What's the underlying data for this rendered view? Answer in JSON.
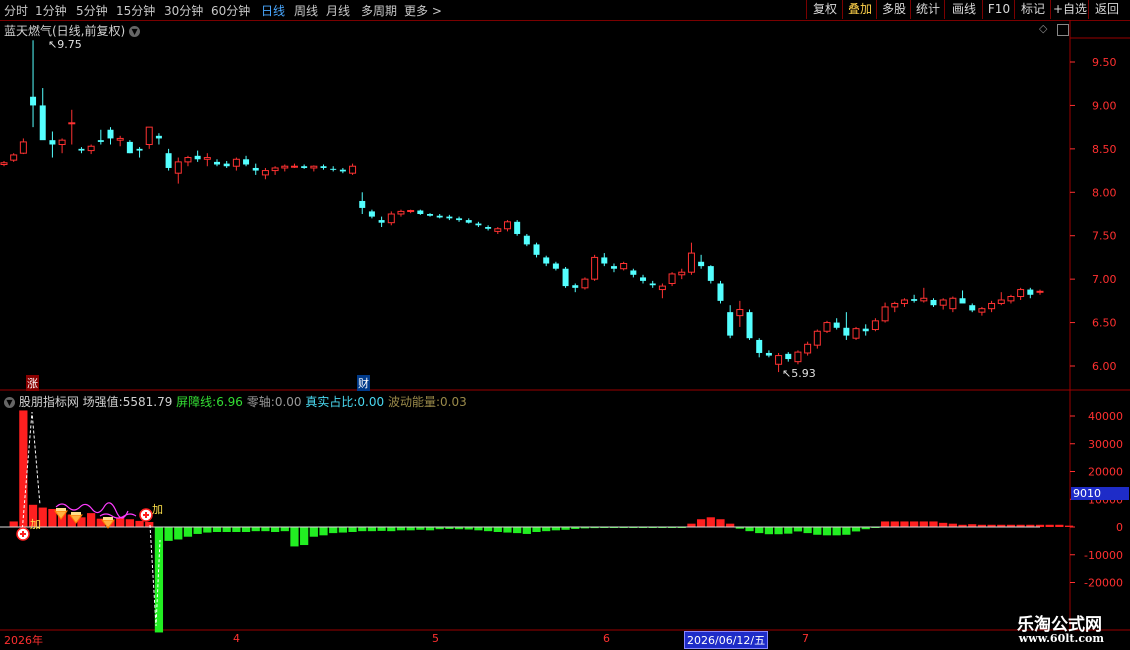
{
  "toolbar": {
    "periods": [
      "分时",
      "1分钟",
      "5分钟",
      "15分钟",
      "30分钟",
      "60分钟",
      "日线",
      "周线",
      "月线",
      "多周期",
      "更多"
    ],
    "active_period": "日线",
    "more_arrow": ">",
    "right_buttons": [
      "复权",
      "叠加",
      "多股",
      "统计",
      "画线",
      "F10",
      "标记",
      "+自选",
      "返回"
    ],
    "active_right": "叠加"
  },
  "main_chart": {
    "title": "蓝天燃气(日线,前复权)",
    "max_label": "9.75",
    "min_label": "5.93",
    "marker_zhang": "涨",
    "marker_cai": "财",
    "y_ticks": [
      "9.50",
      "9.00",
      "8.50",
      "8.00",
      "7.50",
      "7.00",
      "6.50",
      "6.00"
    ]
  },
  "indicator": {
    "name": "股朋指标网",
    "field1_label": "场强值:",
    "field1_value": "5581.79",
    "field2_label": "屏障线:",
    "field2_value": "6.96",
    "field3_label": "零轴:",
    "field3_value": "0.00",
    "field4_label": "真实占比:",
    "field4_value": "0.00",
    "field5_label": "波动能量:",
    "field5_value": "0.03",
    "y_ticks": [
      "40000",
      "30000",
      "20000",
      "10000",
      "0",
      "-10000",
      "-20000"
    ],
    "current_value": "9010",
    "add_label": "加",
    "colors": {
      "positive": "#ff2020",
      "negative": "#22ee22",
      "field2": "#33dd33",
      "field3": "#999999",
      "field4": "#4ad8f0",
      "field5": "#9a8a4a"
    }
  },
  "date_axis": {
    "labels": [
      "2026年",
      "4",
      "5",
      "6",
      "7"
    ],
    "cursor_date": "2026/06/12/五"
  },
  "watermark": {
    "line1": "乐淘公式网",
    "line2": "www.60lt.com"
  },
  "chart_data": {
    "type": "candlestick",
    "ylim": [
      5.75,
      9.9
    ],
    "candles": [
      [
        8.32,
        8.36,
        8.3,
        8.34
      ],
      [
        8.37,
        8.45,
        8.35,
        8.43
      ],
      [
        8.45,
        8.62,
        8.44,
        8.58
      ],
      [
        9.1,
        9.75,
        8.75,
        9.0
      ],
      [
        9.0,
        9.2,
        8.9,
        8.6
      ],
      [
        8.6,
        8.7,
        8.4,
        8.55
      ],
      [
        8.55,
        8.62,
        8.45,
        8.6
      ],
      [
        8.8,
        8.95,
        8.55,
        8.8
      ],
      [
        8.5,
        8.52,
        8.45,
        8.48
      ],
      [
        8.48,
        8.55,
        8.44,
        8.53
      ],
      [
        8.6,
        8.72,
        8.55,
        8.58
      ],
      [
        8.72,
        8.75,
        8.55,
        8.62
      ],
      [
        8.6,
        8.65,
        8.53,
        8.62
      ],
      [
        8.58,
        8.6,
        8.45,
        8.45
      ],
      [
        8.5,
        8.52,
        8.4,
        8.48
      ],
      [
        8.55,
        8.72,
        8.5,
        8.75
      ],
      [
        8.65,
        8.68,
        8.55,
        8.62
      ],
      [
        8.45,
        8.5,
        8.25,
        8.28
      ],
      [
        8.22,
        8.4,
        8.1,
        8.35
      ],
      [
        8.35,
        8.42,
        8.3,
        8.4
      ],
      [
        8.42,
        8.48,
        8.35,
        8.38
      ],
      [
        8.38,
        8.45,
        8.3,
        8.4
      ],
      [
        8.35,
        8.38,
        8.3,
        8.32
      ],
      [
        8.33,
        8.36,
        8.28,
        8.3
      ],
      [
        8.3,
        8.4,
        8.25,
        8.38
      ],
      [
        8.38,
        8.42,
        8.3,
        8.32
      ],
      [
        8.28,
        8.33,
        8.2,
        8.25
      ],
      [
        8.2,
        8.28,
        8.15,
        8.25
      ],
      [
        8.25,
        8.3,
        8.2,
        8.28
      ],
      [
        8.28,
        8.32,
        8.24,
        8.3
      ],
      [
        8.3,
        8.33,
        8.28,
        8.3
      ],
      [
        8.3,
        8.32,
        8.27,
        8.28
      ],
      [
        8.28,
        8.31,
        8.24,
        8.3
      ],
      [
        8.3,
        8.32,
        8.26,
        8.28
      ],
      [
        8.27,
        8.3,
        8.24,
        8.26
      ],
      [
        8.26,
        8.28,
        8.22,
        8.24
      ],
      [
        8.22,
        8.33,
        8.2,
        8.3
      ],
      [
        7.9,
        8.0,
        7.75,
        7.82
      ],
      [
        7.78,
        7.8,
        7.7,
        7.72
      ],
      [
        7.68,
        7.72,
        7.6,
        7.65
      ],
      [
        7.65,
        7.78,
        7.62,
        7.75
      ],
      [
        7.75,
        7.8,
        7.72,
        7.78
      ],
      [
        7.78,
        7.8,
        7.76,
        7.79
      ],
      [
        7.79,
        7.8,
        7.74,
        7.75
      ],
      [
        7.75,
        7.76,
        7.72,
        7.73
      ],
      [
        7.73,
        7.75,
        7.7,
        7.71
      ],
      [
        7.72,
        7.74,
        7.68,
        7.7
      ],
      [
        7.7,
        7.72,
        7.66,
        7.68
      ],
      [
        7.68,
        7.7,
        7.64,
        7.65
      ],
      [
        7.64,
        7.66,
        7.6,
        7.62
      ],
      [
        7.6,
        7.62,
        7.56,
        7.58
      ],
      [
        7.55,
        7.6,
        7.52,
        7.58
      ],
      [
        7.58,
        7.68,
        7.55,
        7.66
      ],
      [
        7.66,
        7.68,
        7.5,
        7.52
      ],
      [
        7.5,
        7.52,
        7.38,
        7.4
      ],
      [
        7.4,
        7.42,
        7.25,
        7.28
      ],
      [
        7.25,
        7.27,
        7.15,
        7.18
      ],
      [
        7.18,
        7.2,
        7.1,
        7.12
      ],
      [
        7.12,
        7.14,
        6.9,
        6.92
      ],
      [
        6.93,
        6.95,
        6.85,
        6.9
      ],
      [
        6.9,
        7.02,
        6.88,
        7.0
      ],
      [
        7.0,
        7.28,
        6.98,
        7.25
      ],
      [
        7.25,
        7.3,
        7.15,
        7.18
      ],
      [
        7.15,
        7.18,
        7.08,
        7.12
      ],
      [
        7.12,
        7.2,
        7.1,
        7.18
      ],
      [
        7.1,
        7.12,
        7.02,
        7.05
      ],
      [
        7.02,
        7.05,
        6.95,
        6.98
      ],
      [
        6.95,
        6.98,
        6.9,
        6.93
      ],
      [
        6.88,
        6.95,
        6.78,
        6.92
      ],
      [
        6.95,
        7.08,
        6.92,
        7.06
      ],
      [
        7.05,
        7.12,
        7.0,
        7.08
      ],
      [
        7.08,
        7.42,
        7.05,
        7.3
      ],
      [
        7.2,
        7.28,
        7.12,
        7.15
      ],
      [
        7.15,
        7.16,
        6.95,
        6.98
      ],
      [
        6.95,
        6.98,
        6.72,
        6.75
      ],
      [
        6.62,
        6.7,
        6.32,
        6.35
      ],
      [
        6.58,
        6.75,
        6.45,
        6.65
      ],
      [
        6.62,
        6.65,
        6.3,
        6.32
      ],
      [
        6.3,
        6.32,
        6.1,
        6.15
      ],
      [
        6.15,
        6.18,
        6.1,
        6.12
      ],
      [
        6.02,
        6.15,
        5.93,
        6.12
      ],
      [
        6.14,
        6.16,
        6.05,
        6.08
      ],
      [
        6.05,
        6.18,
        6.02,
        6.16
      ],
      [
        6.15,
        6.28,
        6.12,
        6.25
      ],
      [
        6.24,
        6.42,
        6.2,
        6.4
      ],
      [
        6.4,
        6.52,
        6.38,
        6.5
      ],
      [
        6.5,
        6.55,
        6.42,
        6.44
      ],
      [
        6.44,
        6.62,
        6.3,
        6.35
      ],
      [
        6.32,
        6.45,
        6.3,
        6.43
      ],
      [
        6.43,
        6.48,
        6.35,
        6.4
      ],
      [
        6.42,
        6.55,
        6.4,
        6.52
      ],
      [
        6.52,
        6.73,
        6.5,
        6.68
      ],
      [
        6.68,
        6.74,
        6.62,
        6.72
      ],
      [
        6.72,
        6.78,
        6.68,
        6.76
      ],
      [
        6.77,
        6.82,
        6.73,
        6.75
      ],
      [
        6.75,
        6.9,
        6.73,
        6.78
      ],
      [
        6.76,
        6.78,
        6.68,
        6.7
      ],
      [
        6.7,
        6.78,
        6.65,
        6.76
      ],
      [
        6.66,
        6.8,
        6.62,
        6.78
      ],
      [
        6.78,
        6.87,
        6.75,
        6.72
      ],
      [
        6.7,
        6.72,
        6.62,
        6.64
      ],
      [
        6.62,
        6.68,
        6.58,
        6.66
      ],
      [
        6.66,
        6.75,
        6.62,
        6.72
      ],
      [
        6.72,
        6.85,
        6.7,
        6.76
      ],
      [
        6.75,
        6.82,
        6.72,
        6.8
      ],
      [
        6.8,
        6.9,
        6.76,
        6.88
      ],
      [
        6.88,
        6.9,
        6.78,
        6.82
      ],
      [
        6.85,
        6.88,
        6.82,
        6.86
      ]
    ],
    "indicator_values": [
      0,
      2000,
      42000,
      8000,
      7000,
      6500,
      5500,
      4500,
      3500,
      5000,
      3000,
      2500,
      3200,
      2800,
      2200,
      1800,
      -38000,
      -5000,
      -4500,
      -3500,
      -2500,
      -2000,
      -1800,
      -1800,
      -1800,
      -1800,
      -1500,
      -1500,
      -1800,
      -1500,
      -7000,
      -6500,
      -3500,
      -3000,
      -2200,
      -2000,
      -1800,
      -1500,
      -1500,
      -1400,
      -1500,
      -1200,
      -1200,
      -1000,
      -1200,
      -800,
      -700,
      -800,
      -900,
      -1200,
      -1500,
      -1800,
      -2000,
      -2200,
      -2500,
      -1800,
      -1500,
      -1200,
      -1000,
      -700,
      -500,
      -400,
      -300,
      -200,
      -150,
      -100,
      -100,
      -100,
      -100,
      -100,
      -100,
      1200,
      2800,
      3500,
      2800,
      1200,
      -600,
      -1500,
      -2200,
      -2600,
      -2600,
      -2400,
      -1600,
      -2200,
      -2800,
      -3000,
      -3000,
      -2800,
      -1600,
      -800,
      -300,
      2000,
      2000,
      2000,
      2000,
      2000,
      2000,
      1500,
      1200,
      800,
      1000,
      800,
      800,
      800,
      800,
      800,
      800,
      800,
      800,
      800,
      500
    ]
  }
}
